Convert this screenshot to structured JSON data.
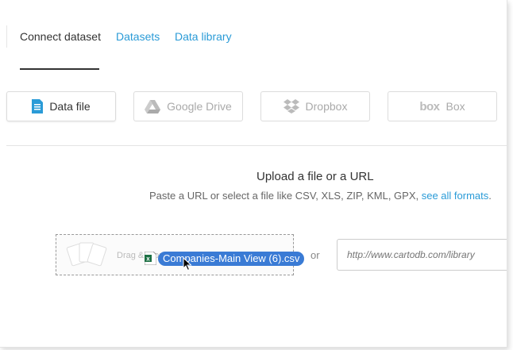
{
  "tabs": {
    "connect_dataset": "Connect dataset",
    "datasets": "Datasets",
    "data_library": "Data library"
  },
  "sources": {
    "data_file": {
      "label": "Data file",
      "icon": "file-icon"
    },
    "google_drive": {
      "label": "Google Drive",
      "icon": "google-drive-icon"
    },
    "dropbox": {
      "label": "Dropbox",
      "icon": "dropbox-icon"
    },
    "box": {
      "label": "Box",
      "logo": "box",
      "icon": "box-logo-icon"
    }
  },
  "upload": {
    "title": "Upload a file or a URL",
    "description": "Paste a URL or select a file like CSV, XLS, ZIP, KML, GPX, ",
    "formats_link": "see all formats",
    "period": ".",
    "dropzone_text": "Drag & drop your file",
    "or": "or",
    "url_placeholder": "http://www.cartodb.com/library"
  },
  "drag": {
    "filename": "Companies-Main View (6).csv",
    "file_icon": "excel-icon"
  },
  "colors": {
    "accent": "#2a9bd7",
    "drag_pill": "#3a7bd5"
  }
}
